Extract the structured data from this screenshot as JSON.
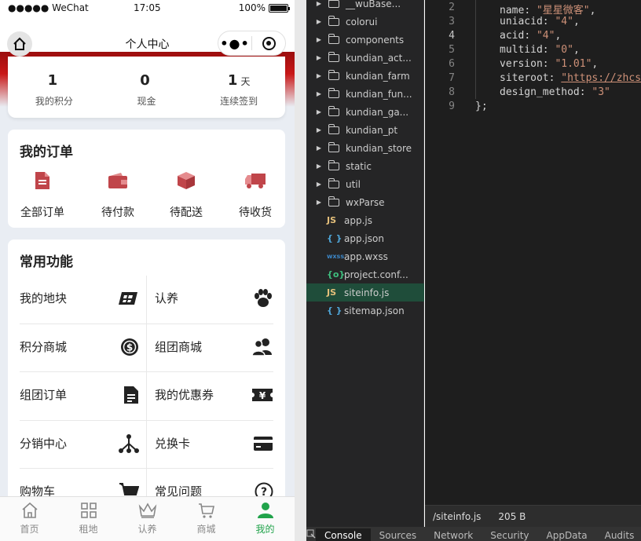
{
  "status_bar": {
    "signal": "●●●●● WeChat",
    "time": "17:05",
    "battery": "100%",
    "battery_level": 1.0
  },
  "nav": {
    "title": "个人中心"
  },
  "stats": [
    {
      "value": "1",
      "unit": "",
      "label": "我的积分"
    },
    {
      "value": "0",
      "unit": "",
      "label": "现金"
    },
    {
      "value": "1",
      "unit": "天",
      "label": "连续签到"
    }
  ],
  "orders": {
    "title": "我的订单",
    "items": [
      {
        "label": "全部订单",
        "icon": "document-icon"
      },
      {
        "label": "待付款",
        "icon": "wallet-icon"
      },
      {
        "label": "待配送",
        "icon": "box-icon"
      },
      {
        "label": "待收货",
        "icon": "truck-icon"
      }
    ]
  },
  "functions": {
    "title": "常用功能",
    "items": [
      {
        "label": "我的地块",
        "icon": "land-icon"
      },
      {
        "label": "认养",
        "icon": "paw-icon"
      },
      {
        "label": "积分商城",
        "icon": "dollar-coin-icon"
      },
      {
        "label": "组团商城",
        "icon": "users-icon"
      },
      {
        "label": "组团订单",
        "icon": "file-icon"
      },
      {
        "label": "我的优惠券",
        "icon": "coupon-icon"
      },
      {
        "label": "分销中心",
        "icon": "network-icon"
      },
      {
        "label": "兑换卡",
        "icon": "card-icon"
      },
      {
        "label": "购物车",
        "icon": "cart-icon"
      },
      {
        "label": "常见问题",
        "icon": "question-icon"
      }
    ]
  },
  "tabbar": [
    {
      "label": "首页",
      "icon": "home-icon",
      "active": false
    },
    {
      "label": "租地",
      "icon": "grid-icon",
      "active": false
    },
    {
      "label": "认养",
      "icon": "crown-icon",
      "active": false
    },
    {
      "label": "商城",
      "icon": "shopping-cart-icon",
      "active": false
    },
    {
      "label": "我的",
      "icon": "user-icon",
      "active": true
    }
  ],
  "file_tree": [
    {
      "name": "__wuBase...",
      "type": "folder"
    },
    {
      "name": "colorui",
      "type": "folder"
    },
    {
      "name": "components",
      "type": "folder"
    },
    {
      "name": "kundian_act...",
      "type": "folder"
    },
    {
      "name": "kundian_farm",
      "type": "folder"
    },
    {
      "name": "kundian_fun...",
      "type": "folder"
    },
    {
      "name": "kundian_ga...",
      "type": "folder"
    },
    {
      "name": "kundian_pt",
      "type": "folder"
    },
    {
      "name": "kundian_store",
      "type": "folder"
    },
    {
      "name": "static",
      "type": "folder"
    },
    {
      "name": "util",
      "type": "folder"
    },
    {
      "name": "wxParse",
      "type": "folder"
    },
    {
      "name": "app.js",
      "type": "js",
      "icon_text": "JS"
    },
    {
      "name": "app.json",
      "type": "json",
      "icon_text": "{ }"
    },
    {
      "name": "app.wxss",
      "type": "wxss",
      "icon_text": "wxss"
    },
    {
      "name": "project.conf...",
      "type": "config",
      "icon_text": "{o}"
    },
    {
      "name": "siteinfo.js",
      "type": "js",
      "icon_text": "JS",
      "selected": true
    },
    {
      "name": "sitemap.json",
      "type": "json",
      "icon_text": "{ }"
    }
  ],
  "editor": {
    "lines": [
      {
        "no": "2",
        "key": "name",
        "value": "\"星星微客\"",
        "tail": ","
      },
      {
        "no": "3",
        "key": "uniacid",
        "value": "\"4\"",
        "tail": ","
      },
      {
        "no": "4",
        "key": "acid",
        "value": "\"4\"",
        "tail": ",",
        "current": true
      },
      {
        "no": "5",
        "key": "multiid",
        "value": "\"0\"",
        "tail": ","
      },
      {
        "no": "6",
        "key": "version",
        "value": "\"1.01\"",
        "tail": ","
      },
      {
        "no": "7",
        "key": "siteroot",
        "value": "\"https://zhcs",
        "tail": "",
        "url": true
      },
      {
        "no": "8",
        "key": "design_method",
        "value": "\"3\"",
        "tail": ""
      },
      {
        "no": "9",
        "text": "};"
      }
    ],
    "status_path": "/siteinfo.js",
    "status_size": "205 B"
  },
  "devtools_tabs": [
    "Console",
    "Sources",
    "Network",
    "Security",
    "AppData",
    "Audits"
  ],
  "colors": {
    "brand_red": "#c0392b",
    "active_green": "#21a34b"
  }
}
